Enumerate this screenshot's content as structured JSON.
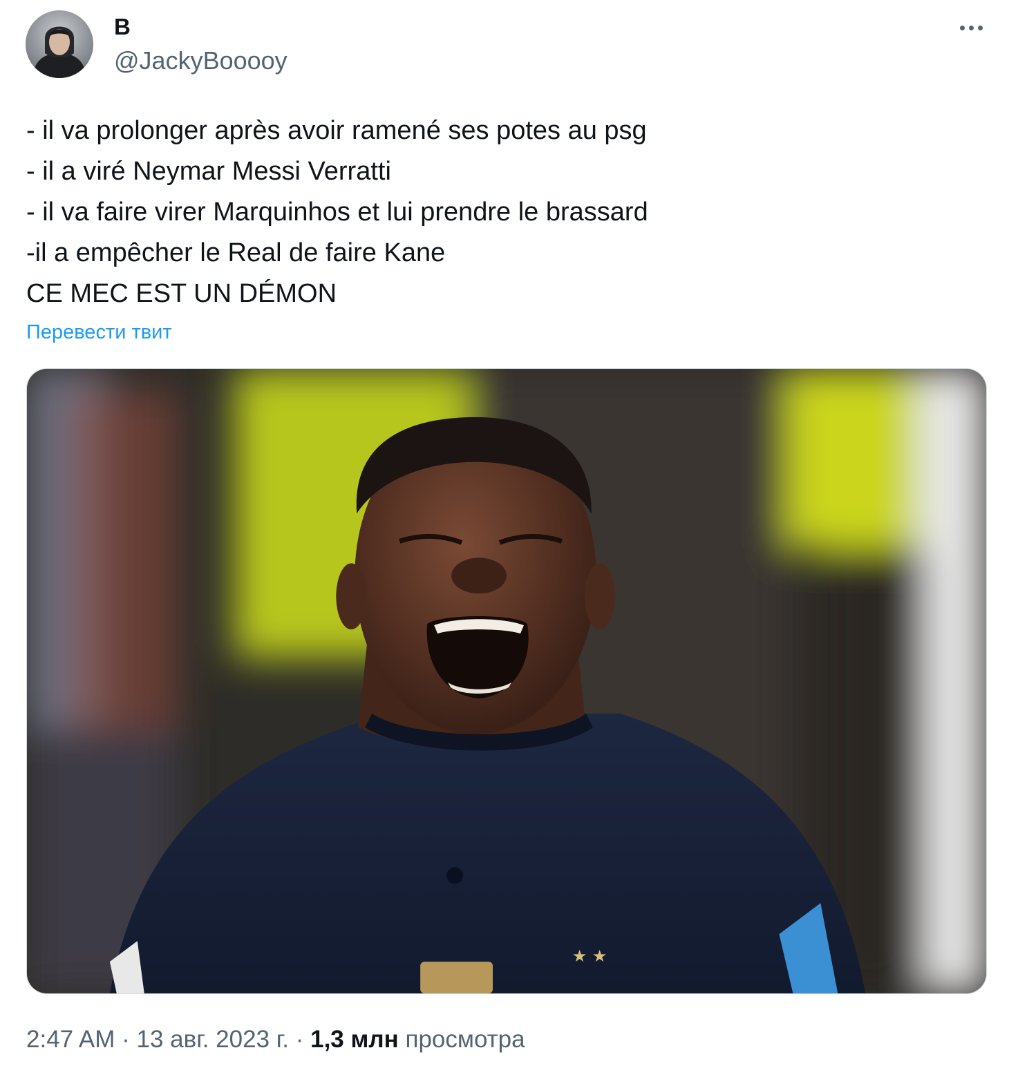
{
  "author": {
    "display_name": "B",
    "handle": "@JackyBooooy"
  },
  "more_icon": "ellipsis-icon",
  "tweet": {
    "lines": [
      "- il va prolonger après avoir ramené ses potes au psg",
      "- il a viré Neymar Messi Verratti",
      "- il va faire virer Marquinhos et lui prendre le brassard",
      "-il a empêcher le Real de faire Kane",
      "CE MEC EST UN DÉMON"
    ],
    "translate_label": "Перевести твит"
  },
  "footer": {
    "time": "2:47 AM",
    "separator": " · ",
    "date": "13 авг. 2023 г.",
    "views_count": "1,3 млн",
    "views_label": "просмотра"
  },
  "colors": {
    "text": "#0f1419",
    "secondary": "#536471",
    "link": "#1d9bf0"
  }
}
